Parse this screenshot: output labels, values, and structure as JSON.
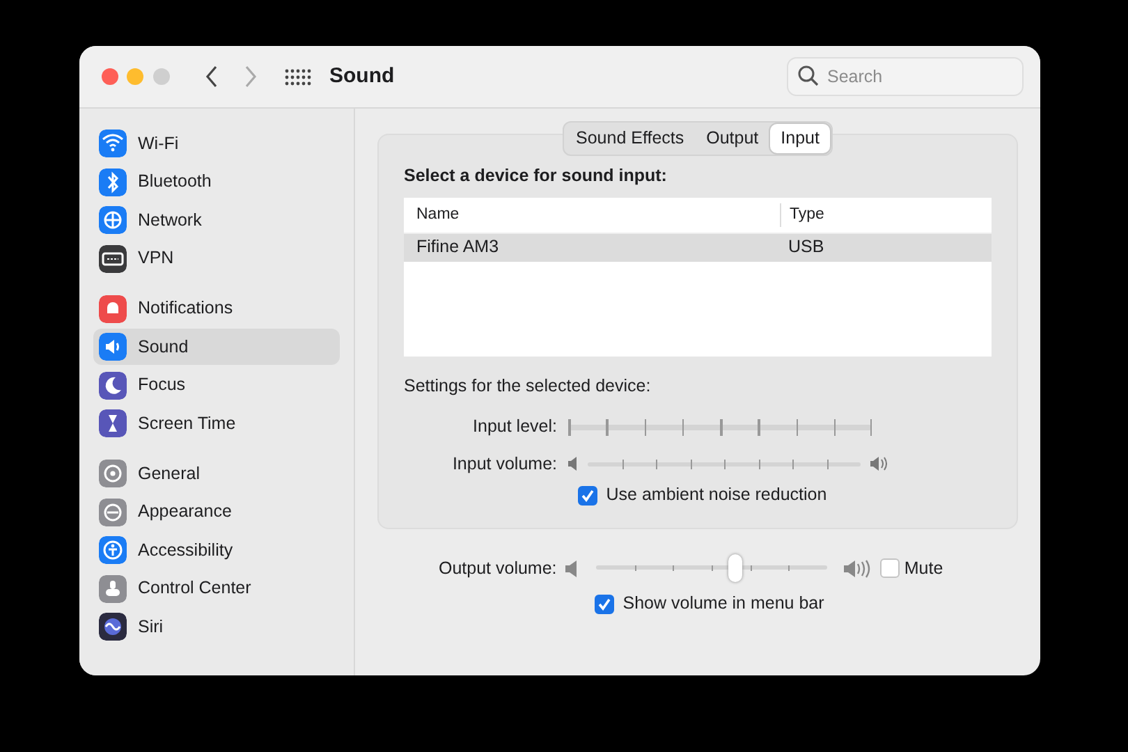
{
  "window": {
    "title": "Sound"
  },
  "search": {
    "placeholder": "Search"
  },
  "sidebar": {
    "groups": [
      {
        "items": [
          {
            "label": "Wi-Fi",
            "kind": "wifi",
            "color": "#1a7cf5",
            "selected": false
          },
          {
            "label": "Bluetooth",
            "kind": "bluetooth",
            "color": "#1a7cf5",
            "selected": false
          },
          {
            "label": "Network",
            "kind": "globe",
            "color": "#1a7cf5",
            "selected": false
          },
          {
            "label": "VPN",
            "kind": "vpn",
            "color": "#3a3a3c",
            "selected": false
          }
        ]
      },
      {
        "items": [
          {
            "label": "Notifications",
            "kind": "bell",
            "color": "#ee4b4b",
            "selected": false
          },
          {
            "label": "Sound",
            "kind": "speaker",
            "color": "#1a7cf5",
            "selected": true
          },
          {
            "label": "Focus",
            "kind": "moon",
            "color": "#5856b8",
            "selected": false
          },
          {
            "label": "Screen Time",
            "kind": "hourglass",
            "color": "#5856b8",
            "selected": false
          }
        ]
      },
      {
        "items": [
          {
            "label": "General",
            "kind": "gear",
            "color": "#8e8e93",
            "selected": false
          },
          {
            "label": "Appearance",
            "kind": "circle",
            "color": "#8e8e93",
            "selected": false
          },
          {
            "label": "Accessibility",
            "kind": "person",
            "color": "#1a7cf5",
            "selected": false
          },
          {
            "label": "Control Center",
            "kind": "toggles",
            "color": "#8e8e93",
            "selected": false
          },
          {
            "label": "Siri",
            "kind": "siri",
            "color": "#2b2b40",
            "selected": false
          }
        ]
      }
    ]
  },
  "tabs": [
    {
      "label": "Sound Effects",
      "selected": false
    },
    {
      "label": "Output",
      "selected": false
    },
    {
      "label": "Input",
      "selected": true
    }
  ],
  "device_section": {
    "heading": "Select a device for sound input:",
    "table": {
      "columns": [
        "Name",
        "Type"
      ],
      "rows": [
        {
          "cells": [
            "Fifine AM3",
            "USB"
          ],
          "selected": true
        }
      ]
    }
  },
  "settings": {
    "heading": "Settings for the selected device:",
    "input_level": {
      "label": "Input level:"
    },
    "input_volume": {
      "label": "Input volume:"
    },
    "noise_reduction": {
      "label": "Use ambient noise reduction",
      "checked": true
    }
  },
  "output_volume": {
    "label": "Output volume:",
    "level": 0.6
  },
  "mute": {
    "label": "Mute",
    "checked": false
  },
  "show_volume": {
    "label": "Show volume in menu bar",
    "checked": true
  }
}
